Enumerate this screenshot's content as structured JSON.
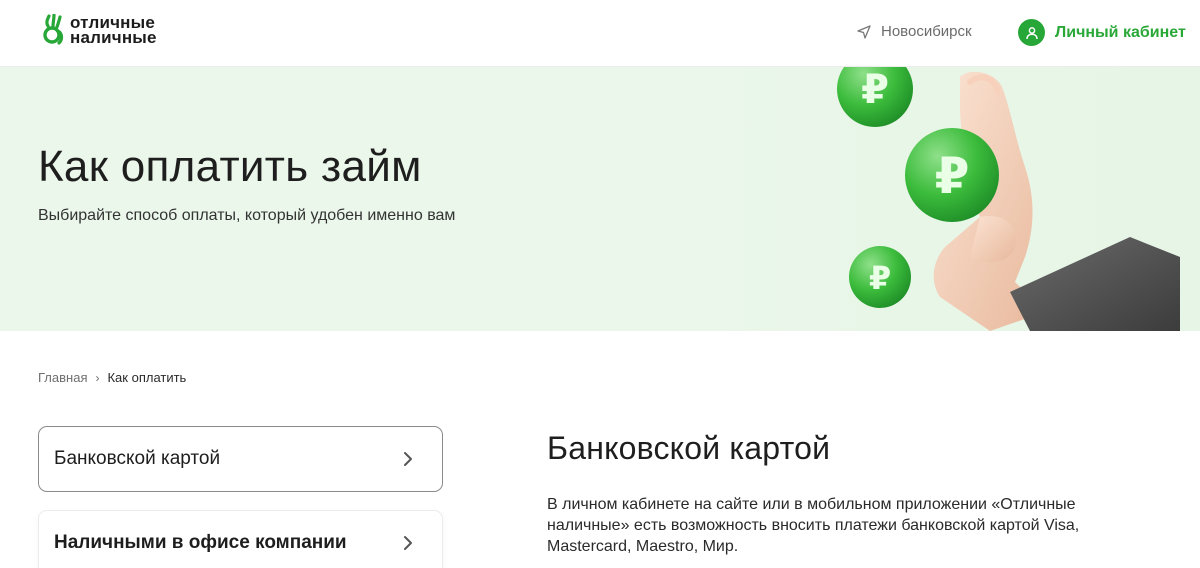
{
  "header": {
    "logo_line1": "отличные",
    "logo_line2": "наличные",
    "city": "Новосибирск",
    "account_label": "Личный кабинет"
  },
  "hero": {
    "title": "Как оплатить займ",
    "subtitle": "Выбирайте способ оплаты, который удобен именно вам"
  },
  "breadcrumb": {
    "home": "Главная",
    "separator": "›",
    "current": "Как оплатить"
  },
  "sidebar": {
    "items": [
      {
        "label": "Банковской картой"
      },
      {
        "label": "Наличными в офисе компании"
      }
    ]
  },
  "content": {
    "title": "Банковской картой",
    "text": "В личном кабинете на сайте или в мобильном приложении «Отличные наличные» есть возможность вносить платежи банковской картой Visa, Mastercard, Maestro, Мир."
  },
  "colors": {
    "brand_green": "#27a737",
    "hero_bg": "#eaf7ea"
  },
  "icons": {
    "logo": "ok-hand-logo-icon",
    "city": "location-arrow-icon",
    "account": "user-icon",
    "chevron": "chevron-right-icon"
  }
}
